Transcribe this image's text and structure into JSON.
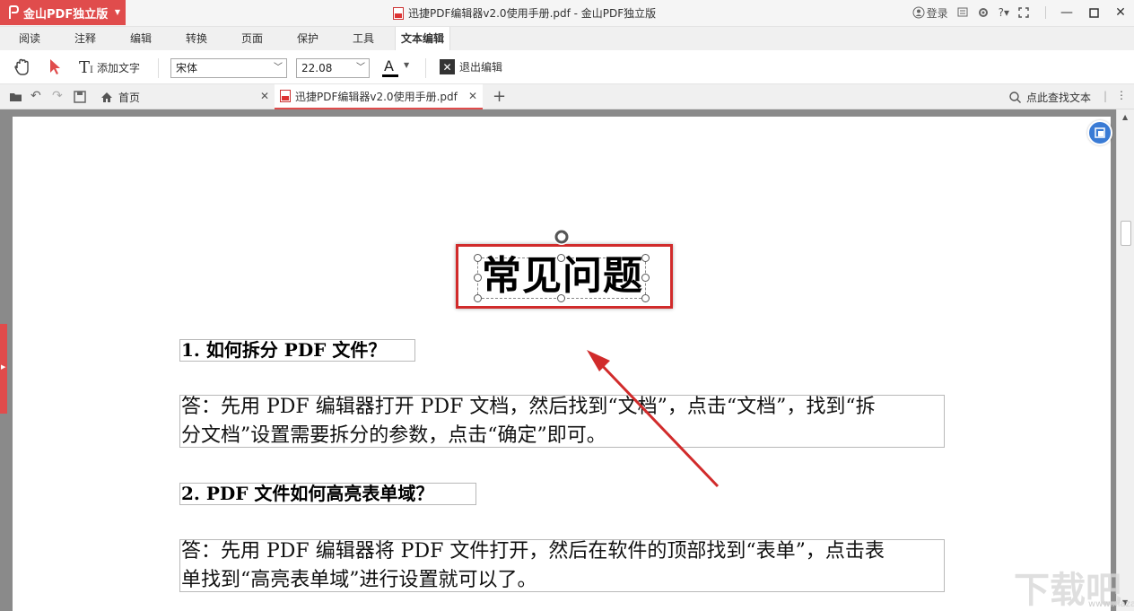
{
  "app": {
    "brand": "金山PDF独立版",
    "window_title": "迅捷PDF编辑器v2.0使用手册.pdf - 金山PDF独立版",
    "login": "登录",
    "accent_color": "#e04c4c"
  },
  "menu": {
    "tabs": [
      "阅读",
      "注释",
      "编辑",
      "转换",
      "页面",
      "保护",
      "工具",
      "文本编辑"
    ],
    "active": "文本编辑"
  },
  "toolbar": {
    "add_text": "添加文字",
    "font": "宋体",
    "font_size": "22.08",
    "exit_edit": "退出编辑"
  },
  "tabs": {
    "home": "首页",
    "doc": "迅捷PDF编辑器v2.0使用手册.pdf",
    "search": "点此查找文本"
  },
  "document": {
    "heading": "常见问题",
    "q1": "1. 如何拆分 PDF 文件？",
    "a1_line1": "答：先用 PDF 编辑器打开 PDF 文档，然后找到“文档”，点击“文档”，找到“拆",
    "a1_line2": "分文档”设置需要拆分的参数，点击“确定”即可。",
    "q2": "2. PDF 文件如何高亮表单域？",
    "a2_line1": "答：先用 PDF 编辑器将 PDF 文件打开，然后在软件的顶部找到“表单”，点击表",
    "a2_line2": "单找到“高亮表单域”进行设置就可以了。"
  },
  "watermark": {
    "main": "下载吧",
    "sub": "www.xiazaiba.com"
  }
}
